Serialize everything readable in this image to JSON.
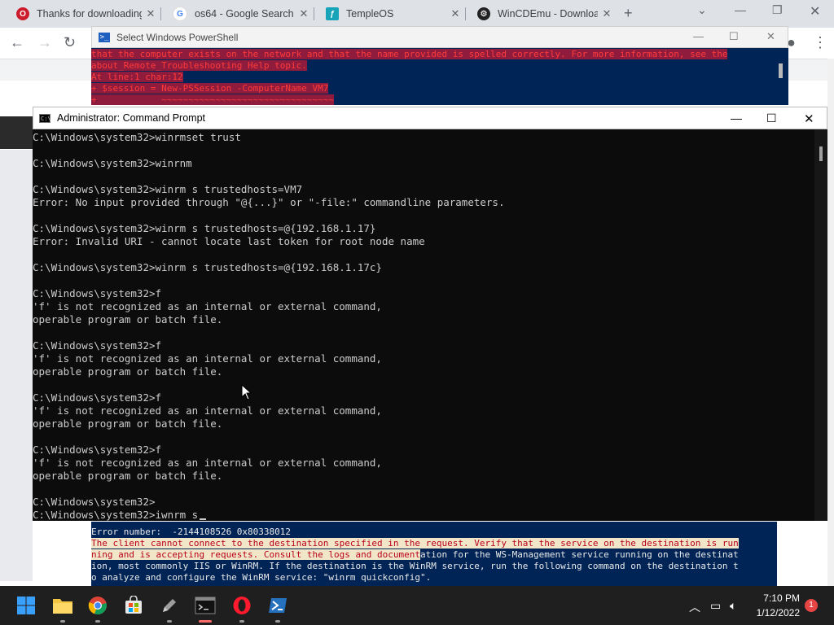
{
  "browser": {
    "tabs": [
      {
        "title": "Thanks for downloading",
        "icon": "opera-icon"
      },
      {
        "title": "os64 - Google Search",
        "icon": "google-icon"
      },
      {
        "title": "TempleOS",
        "icon": "templeos-icon"
      },
      {
        "title": "WinCDEmu - Download",
        "icon": "wincdemu-icon"
      }
    ],
    "new_tab": "+",
    "close_glyph": "✕"
  },
  "powershell": {
    "title": "Select Windows PowerShell",
    "lines": [
      "that the computer exists on the network and that the name provided is spelled correctly. For more information, see the",
      "about_Remote_Troubleshooting Help topic.",
      "At line:1 char:12",
      "+ $session = New-PSSession -ComputerName VM7",
      "+            ~~~~~~~~~~~~~~~~~~~~~~~~~~~~~~~~"
    ]
  },
  "cmd": {
    "title": "Administrator: Command Prompt",
    "lines": [
      "C:\\Windows\\system32>winrmset trust",
      "",
      "C:\\Windows\\system32>winrnm",
      "",
      "C:\\Windows\\system32>winrm s trustedhosts=VM7",
      "Error: No input provided through \"@{...}\" or \"-file:\" commandline parameters.",
      "",
      "C:\\Windows\\system32>winrm s trustedhosts=@{192.168.1.17}",
      "Error: Invalid URI - cannot locate last token for root node name",
      "",
      "C:\\Windows\\system32>winrm s trustedhosts=@{192.168.1.17c}",
      "",
      "C:\\Windows\\system32>f",
      "'f' is not recognized as an internal or external command,",
      "operable program or batch file.",
      "",
      "C:\\Windows\\system32>f",
      "'f' is not recognized as an internal or external command,",
      "operable program or batch file.",
      "",
      "C:\\Windows\\system32>f",
      "'f' is not recognized as an internal or external command,",
      "operable program or batch file.",
      "",
      "C:\\Windows\\system32>f",
      "'f' is not recognized as an internal or external command,",
      "operable program or batch file.",
      "",
      "C:\\Windows\\system32>",
      "C:\\Windows\\system32>iwnrm s"
    ]
  },
  "ps_error": {
    "line1": "Error number:  -2144108526 0x80338012",
    "line2": "The client cannot connect to the destination specified in the request. Verify that the service on the destination is run",
    "line3_sel": "ning and is accepting requests. Consult the logs and document",
    "line3_rest": "ation for the WS-Management service running on the destinat",
    "line4": "ion, most commonly IIS or WinRM. If the destination is the WinRM service, run the following command on the destination t",
    "line5": "o analyze and configure the WinRM service: \"winrm quickconfig\"."
  },
  "taskbar": {
    "clock_time": "7:10 PM",
    "clock_date": "1/12/2022",
    "notifications": "1"
  },
  "colors": {
    "ps_bg": "#012456",
    "cmd_bg": "#0c0c0c",
    "taskbar_bg": "#1f1f1f"
  }
}
